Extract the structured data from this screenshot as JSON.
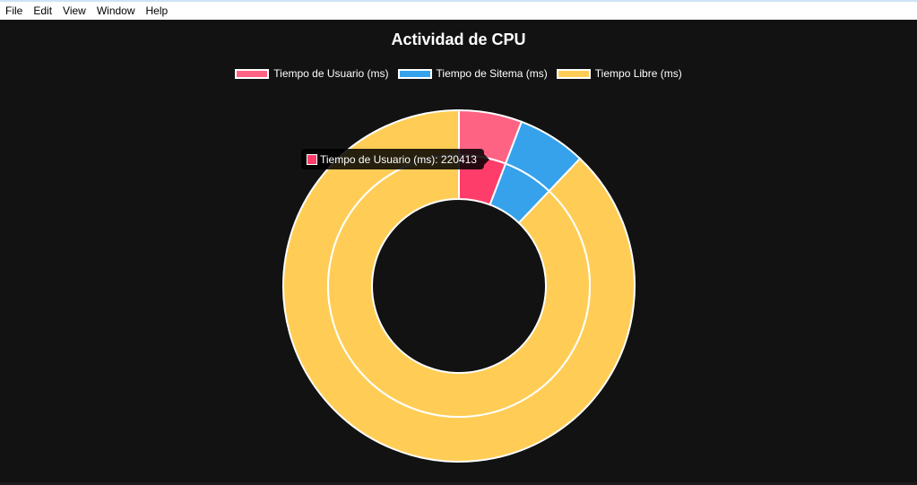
{
  "menu": [
    "File",
    "Edit",
    "View",
    "Window",
    "Help"
  ],
  "colors": {
    "user": "#ff6384",
    "user_active": "#ff3d6a",
    "system": "#36a2eb",
    "idle": "#ffcd56",
    "background": "#121212"
  },
  "tooltip": {
    "text": "Tiempo de Usuario (ms): 220413",
    "color": "#ff3d6a"
  },
  "chart_data": {
    "type": "pie",
    "variant": "doughnut",
    "title": "Actividad de CPU",
    "legend": [
      "Tiempo de Usuario (ms)",
      "Tiempo de Sitema (ms)",
      "Tiempo Libre (ms)"
    ],
    "legend_placement": "top",
    "rings": [
      {
        "position": "outer",
        "values": [
          0.058,
          0.063,
          0.879
        ]
      },
      {
        "position": "inner",
        "values": [
          0.058,
          0.063,
          0.879
        ]
      }
    ]
  }
}
